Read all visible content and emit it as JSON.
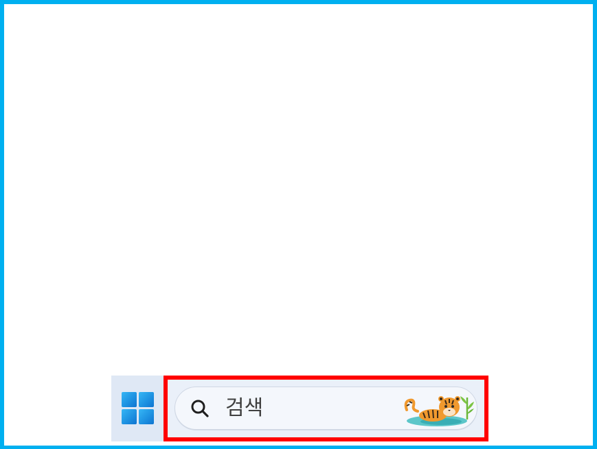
{
  "taskbar": {
    "start_button": {
      "icon": "windows-logo-icon",
      "color": "#1c8fe0"
    },
    "search_box": {
      "icon": "search-icon",
      "placeholder": "검색",
      "highlight_color": "#ff0000",
      "decoration": "tiger-illustration"
    }
  },
  "frame_color": "#00b0f0"
}
